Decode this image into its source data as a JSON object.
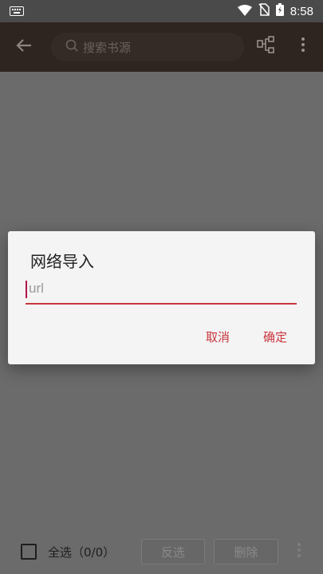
{
  "status_bar": {
    "time": "8:58",
    "icons": [
      "keyboard-icon",
      "wifi-icon",
      "no-sim-icon",
      "battery-icon"
    ]
  },
  "toolbar": {
    "search_placeholder": "搜索书源",
    "icons": [
      "back-arrow-icon",
      "search-icon",
      "group-icon",
      "more-vert-icon"
    ]
  },
  "dialog": {
    "title": "网络导入",
    "input_placeholder": "url",
    "input_value": "",
    "cancel_label": "取消",
    "ok_label": "确定"
  },
  "bottom_bar": {
    "select_all_label": "全选（0/0）",
    "invert_label": "反选",
    "delete_label": "删除"
  },
  "colors": {
    "accent": "#c9353c",
    "toolbar": "#2e2420",
    "scrim": "#6b6b6b",
    "dialog_bg": "#f4f4f4"
  }
}
